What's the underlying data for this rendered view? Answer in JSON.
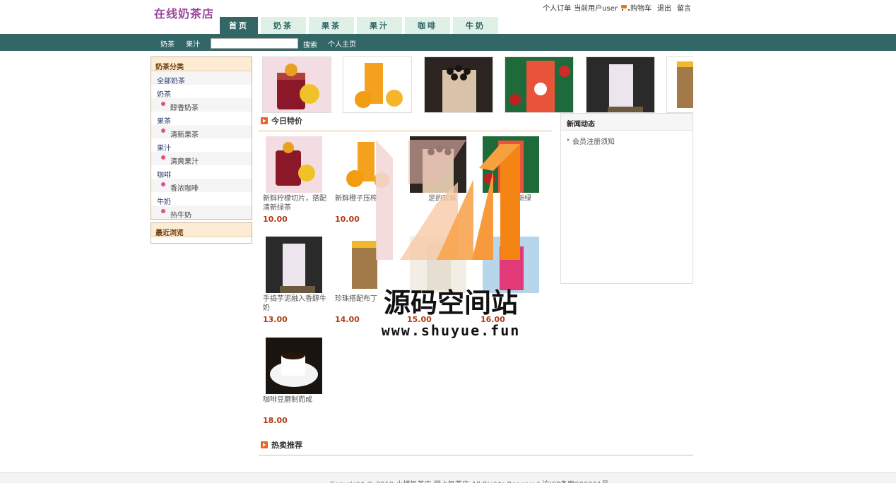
{
  "logo": "在线奶茶店",
  "toplinks": {
    "orders": "个人订单",
    "current_user": "当前用户user",
    "cart": "购物车",
    "logout": "退出",
    "message": "留言"
  },
  "tabs": [
    "首页",
    "奶茶",
    "果茶",
    "果汁",
    "咖啡",
    "牛奶"
  ],
  "navbar": {
    "links": [
      "奶茶",
      "果汁"
    ],
    "search_value": "",
    "search_button": "搜索",
    "home": "个人主页"
  },
  "sidebar": {
    "category_title": "奶茶分类",
    "categories": [
      {
        "name": "全部奶茶",
        "child": null
      },
      {
        "name": "奶茶",
        "child": "醇香奶茶"
      },
      {
        "name": "果茶",
        "child": "清新果茶"
      },
      {
        "name": "果汁",
        "child": "清爽果汁"
      },
      {
        "name": "咖啡",
        "child": "香浓咖啡"
      },
      {
        "name": "牛奶",
        "child": "热牛奶"
      }
    ],
    "recent_title": "最近浏览"
  },
  "sections": {
    "today_special": "今日特价",
    "hot_sale": "热卖推荐"
  },
  "products": [
    {
      "desc": "新鲜柠檬切片，搭配清新绿茶",
      "price": "10.00",
      "img": "lemon-tea"
    },
    {
      "desc": "新鲜橙子压榨",
      "price": "10.00",
      "img": "orange-juice"
    },
    {
      "desc": "足的珍珠",
      "price": "",
      "img": "pearl-milk-tea"
    },
    {
      "desc": "清新绿",
      "price": "",
      "img": "red-fruit-tea"
    },
    {
      "desc": "手捣芋泥融入香醇牛奶",
      "price": "13.00",
      "img": "taro-milk"
    },
    {
      "desc": "珍珠搭配布丁",
      "price": "14.00",
      "img": "pudding-tea"
    },
    {
      "desc": "",
      "price": "15.00",
      "img": "milk-cup"
    },
    {
      "desc": "",
      "price": "16.00",
      "img": "berry-drink"
    },
    {
      "desc": "咖啡豆磨制而成",
      "price": "18.00",
      "img": "coffee"
    }
  ],
  "news": {
    "title": "新闻动态",
    "items": [
      "会员注册须知"
    ]
  },
  "watermark": {
    "title": "源码空间站",
    "url": "www.shuyue.fun"
  },
  "footer": "Copyright © 2019 小楼奶茶店-网上奶茶店 All Rights Reserved  沪ICP备案000001号",
  "colors": {
    "nav_bg": "#336666",
    "tab_bg": "#dff0e6",
    "logo": "#9b4a9b",
    "price": "#b23a14"
  }
}
